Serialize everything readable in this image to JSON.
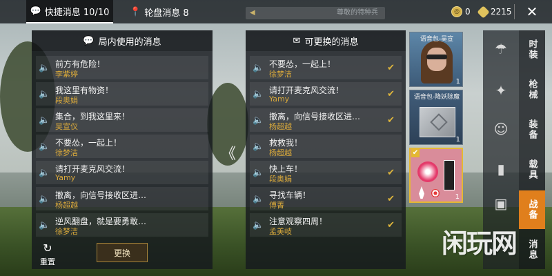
{
  "topbar": {
    "tab_quick": "快捷消息 10/10",
    "tab_wheel": "轮盘消息 8",
    "search_placeholder": "尊敬的特种兵",
    "currency": [
      {
        "icon": "medal-coin-icon",
        "value": "0"
      },
      {
        "icon": "gold-crystal-icon",
        "value": "2215"
      }
    ],
    "close_icon": "close-icon"
  },
  "left_panel": {
    "title": "局内使用的消息",
    "messages": [
      {
        "text": "前方有危险！",
        "author": "李紫婷"
      },
      {
        "text": "我这里有物资！",
        "author": "段奥娟"
      },
      {
        "text": "集合，到我这里来！",
        "author": "吴宣仪"
      },
      {
        "text": "不要怂，一起上！",
        "author": "徐梦洁"
      },
      {
        "text": "请打开麦克风交流！",
        "author": "Yamy"
      },
      {
        "text": "撤离，向信号接收区进…",
        "author": "杨超越"
      },
      {
        "text": "逆风翻盘，就是要勇敢…",
        "author": "徐梦洁"
      }
    ],
    "reset_label": "重置",
    "replace_label": "更换"
  },
  "right_panel": {
    "title": "可更换的消息",
    "messages": [
      {
        "text": "不要怂，一起上！",
        "author": "徐梦洁",
        "checked": true
      },
      {
        "text": "请打开麦克风交流！",
        "author": "Yamy",
        "checked": true
      },
      {
        "text": "撤离，向信号接收区进…",
        "author": "杨超越",
        "checked": true
      },
      {
        "text": "救救我！",
        "author": "杨超越",
        "checked": false
      },
      {
        "text": "快上车！",
        "author": "段奥娟",
        "checked": true
      },
      {
        "text": "寻找车辆！",
        "author": "傅菁",
        "checked": true
      },
      {
        "text": "注意观察四周！",
        "author": "孟美岐",
        "checked": true
      }
    ]
  },
  "cards": [
    {
      "label": "语音包-吴宣",
      "qty": "1"
    },
    {
      "label": "语音包-降妖除魔",
      "qty": "1"
    },
    {
      "label": "",
      "qty": "1",
      "selected": true
    }
  ],
  "rail": {
    "icons": [
      "parachute-icon",
      "gun-icon",
      "grenade-face-icon",
      "spray-icon",
      "image-icon"
    ],
    "tabs": [
      {
        "label": "时装",
        "active": false
      },
      {
        "label": "枪械",
        "active": false
      },
      {
        "label": "装备",
        "active": false
      },
      {
        "label": "载具",
        "active": false
      },
      {
        "label": "战备",
        "active": true
      },
      {
        "label": "消息",
        "active": false
      }
    ]
  },
  "watermark": "闲玩网",
  "colors": {
    "accent": "#e07f1c",
    "author": "#d9a93b",
    "check": "#e0b73c"
  }
}
